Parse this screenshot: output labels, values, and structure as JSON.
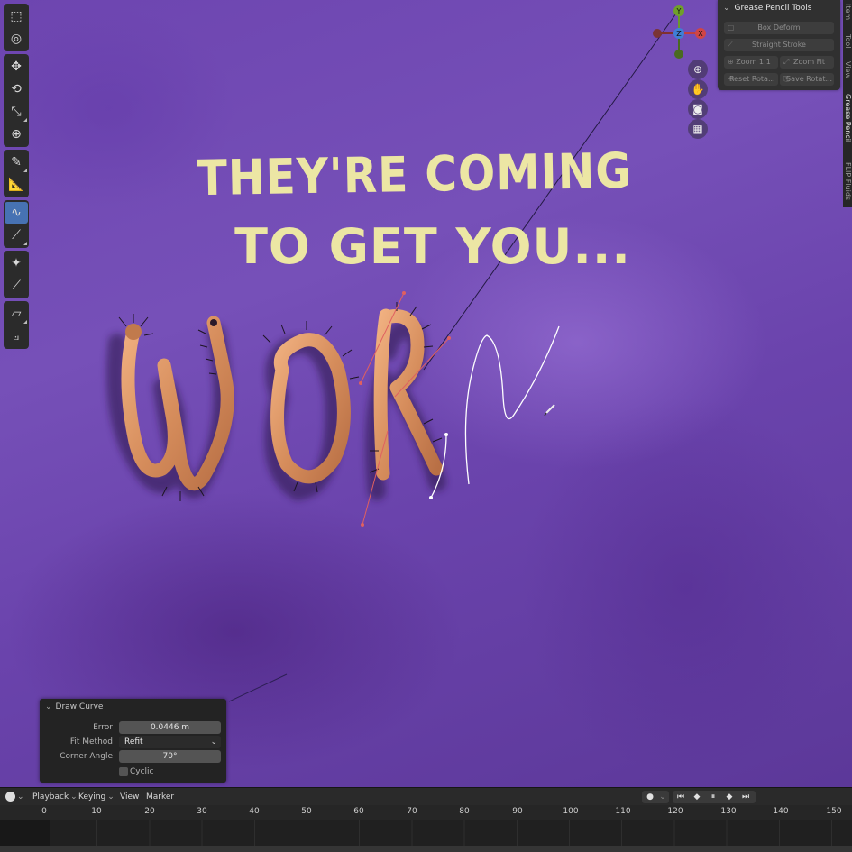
{
  "scene": {
    "caption_line1": "THEY'RE COMING",
    "caption_line2": "TO GET YOU...",
    "worm_text": "WOR",
    "colors": {
      "caption": "#ece6a4",
      "worm": "#d68d5c",
      "background": "#6d45b0"
    }
  },
  "toolbar": {
    "tools": [
      "select-box-icon",
      "cursor-icon",
      "move-icon",
      "rotate-icon",
      "scale-icon",
      "transform-icon",
      "annotate-icon",
      "measure-icon",
      "draw-curve-icon",
      "line-icon",
      "tweak-icon",
      "knife-icon",
      "erase-icon",
      "polyline-icon"
    ],
    "active_tool": "draw-curve-icon"
  },
  "gizmo": {
    "y": "Y",
    "z": "Z",
    "x": "X"
  },
  "npanel": {
    "title": "Grease Pencil Tools",
    "buttons": {
      "box_deform": "Box Deform",
      "straight_stroke": "Straight Stroke",
      "zoom_11": "Zoom 1:1",
      "zoom_fit": "Zoom Fit",
      "reset_rotate": "Reset Rota...",
      "save_rotate": "Save Rotat..."
    },
    "tabs": [
      "Item",
      "Tool",
      "View",
      "Grease Pencil",
      "FLIP Fluids"
    ]
  },
  "draw_curve": {
    "title": "Draw Curve",
    "error_label": "Error",
    "error_value": "0.0446 m",
    "fit_method_label": "Fit Method",
    "fit_method_value": "Refit",
    "corner_angle_label": "Corner Angle",
    "corner_angle_value": "70°",
    "cyclic_label": "Cyclic",
    "cyclic_checked": false
  },
  "timeline": {
    "menus": {
      "playback": "Playback",
      "keying": "Keying",
      "view": "View",
      "marker": "Marker"
    },
    "ticks": [
      "0",
      "10",
      "20",
      "30",
      "40",
      "50",
      "60",
      "70",
      "80",
      "90",
      "100",
      "110",
      "120",
      "130",
      "140",
      "150"
    ]
  }
}
